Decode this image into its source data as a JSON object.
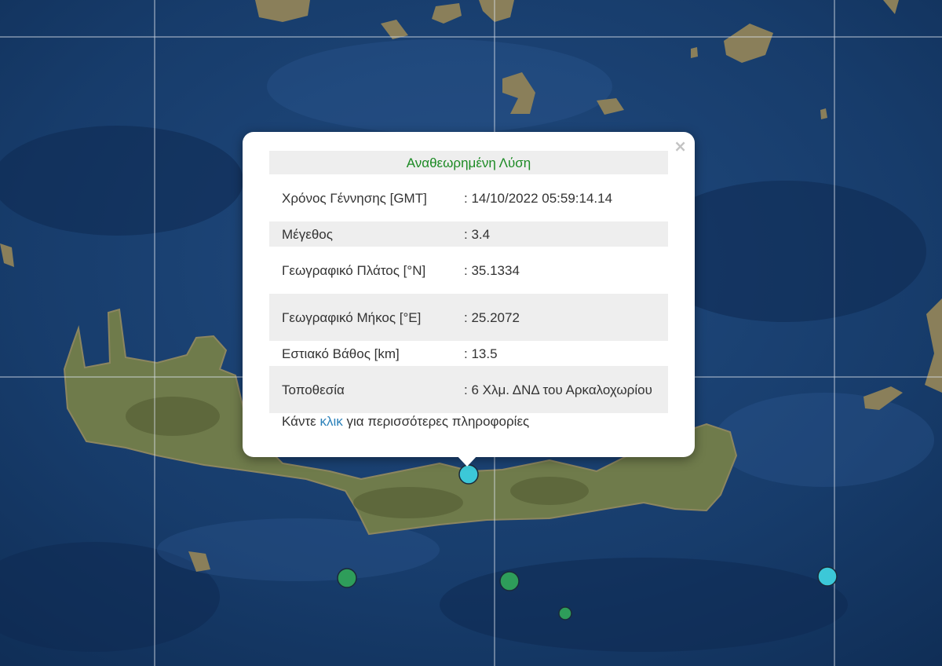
{
  "popup": {
    "header": "Αναθεωρημένη Λύση",
    "close_icon": "close-icon",
    "rows": [
      {
        "label": "Χρόνος Γέννησης [GMT]",
        "value": ": 14/10/2022 05:59:14.14"
      },
      {
        "label": "Μέγεθος",
        "value": ": 3.4"
      },
      {
        "label": "Γεωγραφικό Πλάτος [°N]",
        "value": ": 35.1334"
      },
      {
        "label": "Γεωγραφικό Μήκος [°E]",
        "value": ": 25.2072"
      },
      {
        "label": "Εστιακό Βάθος [km]",
        "value": ": 13.5"
      },
      {
        "label": "Τοποθεσία",
        "value": ": 6 Χλμ. ΔΝΔ του Αρκαλοχωρίου"
      }
    ],
    "footer": {
      "prefix": "Κάντε ",
      "link": "κλικ",
      "suffix": " για περισσότερες πληροφορίες"
    }
  },
  "colors": {
    "sea": "#1a3d6e",
    "land": "#6d7a4a",
    "graticule": "#d9dfe8",
    "marker_cyan": "#3cc8d8",
    "marker_green": "#2e9d5a",
    "header_green": "#1c8a24",
    "link_blue": "#2a80b9"
  }
}
